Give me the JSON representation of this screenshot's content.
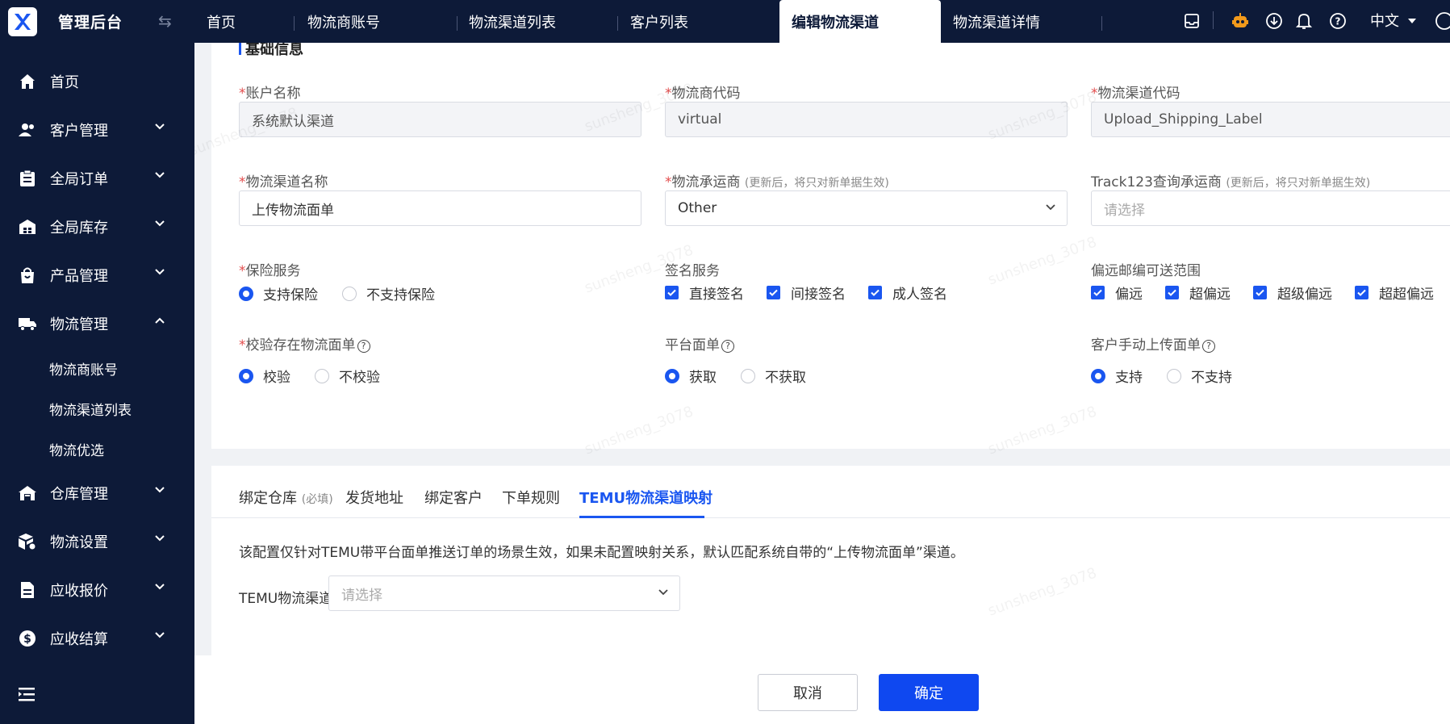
{
  "app": {
    "title": "管理后台"
  },
  "sidebar": {
    "items": [
      {
        "label": "首页"
      },
      {
        "label": "客户管理"
      },
      {
        "label": "全局订单"
      },
      {
        "label": "全局库存"
      },
      {
        "label": "产品管理"
      },
      {
        "label": "物流管理"
      },
      {
        "label": "仓库管理"
      },
      {
        "label": "物流设置"
      },
      {
        "label": "应收报价"
      },
      {
        "label": "应收结算"
      }
    ],
    "submenu": [
      {
        "label": "物流商账号"
      },
      {
        "label": "物流渠道列表"
      },
      {
        "label": "物流优选"
      }
    ]
  },
  "tabs": [
    {
      "label": "首页"
    },
    {
      "label": "物流商账号"
    },
    {
      "label": "物流渠道列表"
    },
    {
      "label": "客户列表"
    },
    {
      "label": "编辑物流渠道"
    },
    {
      "label": "物流渠道详情"
    }
  ],
  "topbar": {
    "language": "中文"
  },
  "section": {
    "title": "基础信息"
  },
  "form": {
    "account_name": {
      "label": "账户名称",
      "value": "系统默认渠道"
    },
    "carrier_code": {
      "label": "物流商代码",
      "value": "virtual"
    },
    "channel_code": {
      "label": "物流渠道代码",
      "value": "Upload_Shipping_Label"
    },
    "channel_name": {
      "label": "物流渠道名称",
      "value": "上传物流面单"
    },
    "shipper": {
      "label": "物流承运商",
      "hint": "(更新后，将只对新单据生效)",
      "value": "Other"
    },
    "track123": {
      "label": "Track123查询承运商",
      "hint": "(更新后，将只对新单据生效)",
      "placeholder": "请选择"
    },
    "insurance": {
      "label": "保险服务",
      "options": [
        "支持保险",
        "不支持保险"
      ],
      "selected": "支持保险"
    },
    "signature": {
      "label": "签名服务",
      "options": [
        "直接签名",
        "间接签名",
        "成人签名"
      ]
    },
    "remote": {
      "label": "偏远邮编可送范围",
      "options": [
        "偏远",
        "超偏远",
        "超级偏远",
        "超超偏远"
      ]
    },
    "verify_label": {
      "label": "校验存在物流面单",
      "options": [
        "校验",
        "不校验"
      ],
      "selected": "校验"
    },
    "platform_label": {
      "label": "平台面单",
      "options": [
        "获取",
        "不获取"
      ],
      "selected": "获取"
    },
    "manual_upload": {
      "label": "客户手动上传面单",
      "options": [
        "支持",
        "不支持"
      ],
      "selected": "支持"
    }
  },
  "subtabs": [
    {
      "label": "绑定仓库",
      "hint": "(必填)"
    },
    {
      "label": "发货地址"
    },
    {
      "label": "绑定客户"
    },
    {
      "label": "下单规则"
    },
    {
      "label": "TEMU物流渠道映射"
    }
  ],
  "temu": {
    "notice": "该配置仅针对TEMU带平台面单推送订单的场景生效，如果未配置映射关系，默认匹配系统自带的“上传物流面单”渠道。",
    "label": "TEMU物流渠道",
    "placeholder": "请选择"
  },
  "footer": {
    "cancel": "取消",
    "confirm": "确定"
  },
  "watermark": "sunsheng_3078",
  "colors": {
    "primary": "#1a56f0",
    "sidebar_bg": "#0d1a38",
    "required": "#e34d4d"
  }
}
